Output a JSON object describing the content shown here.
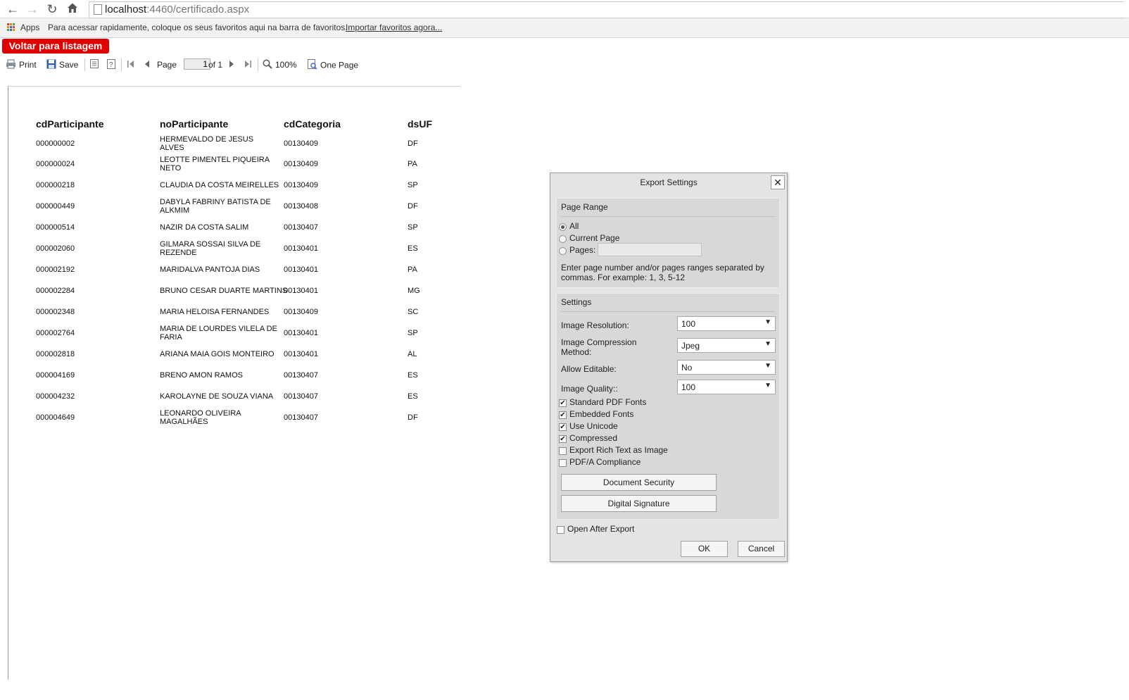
{
  "browser": {
    "url_host": "localhost",
    "url_path": ":4460/certificado.aspx",
    "bookmarks": {
      "apps_label": "Apps",
      "hint": "Para acessar rapidamente, coloque os seus favoritos aqui na barra de favoritos.",
      "import_link": "Importar favoritos agora..."
    }
  },
  "viewer": {
    "back_button": "Voltar para listagem",
    "toolbar": {
      "print": "Print",
      "save": "Save",
      "page_label": "Page",
      "page_value": "1",
      "page_of": "of 1",
      "zoom": "100%",
      "view_mode": "One Page"
    }
  },
  "report": {
    "columns": [
      "cdParticipante",
      "noParticipante",
      "cdCategoria",
      "dsUF"
    ],
    "rows": [
      [
        "000000002",
        "HERMEVALDO DE JESUS ALVES",
        "00130409",
        "DF"
      ],
      [
        "000000024",
        "LEOTTE PIMENTEL PIQUEIRA NETO",
        "00130409",
        "PA"
      ],
      [
        "000000218",
        "CLAUDIA DA COSTA MEIRELLES",
        "00130409",
        "SP"
      ],
      [
        "000000449",
        "DABYLA FABRINY BATISTA DE ALKMIM",
        "00130408",
        "DF"
      ],
      [
        "000000514",
        "NAZIR DA COSTA SALIM",
        "00130407",
        "SP"
      ],
      [
        "000002060",
        "GILMARA SOSSAI SILVA DE REZENDE",
        "00130401",
        "ES"
      ],
      [
        "000002192",
        "MARIDALVA PANTOJA DIAS",
        "00130401",
        "PA"
      ],
      [
        "000002284",
        "BRUNO CESAR DUARTE MARTINS",
        "00130401",
        "MG"
      ],
      [
        "000002348",
        "MARIA HELOISA FERNANDES",
        "00130409",
        "SC"
      ],
      [
        "000002764",
        "MARIA DE LOURDES VILELA DE FARIA",
        "00130401",
        "SP"
      ],
      [
        "000002818",
        "ARIANA MAIA GOIS MONTEIRO",
        "00130401",
        "AL"
      ],
      [
        "000004169",
        "BRENO AMON RAMOS",
        "00130407",
        "ES"
      ],
      [
        "000004232",
        "KAROLAYNE DE SOUZA VIANA",
        "00130407",
        "ES"
      ],
      [
        "000004649",
        "LEONARDO OLIVEIRA MAGALHÃES",
        "00130407",
        "DF"
      ]
    ]
  },
  "dialog": {
    "title": "Export Settings",
    "close_glyph": "✕",
    "page_range": {
      "title": "Page Range",
      "all": "All",
      "current_page": "Current Page",
      "pages": "Pages:",
      "pages_value": "",
      "help": "Enter page number and/or pages ranges separated by commas. For example: 1, 3, 5-12"
    },
    "settings": {
      "title": "Settings",
      "image_resolution_label": "Image Resolution:",
      "image_resolution_value": "100",
      "compression_label": "Image Compression Method:",
      "compression_value": "Jpeg",
      "allow_editable_label": "Allow Editable:",
      "allow_editable_value": "No",
      "image_quality_label": "Image Quality::",
      "image_quality_value": "100",
      "standard_pdf_fonts": "Standard PDF Fonts",
      "standard_pdf_fonts_checked": true,
      "embedded_fonts": "Embedded Fonts",
      "embedded_fonts_checked": true,
      "use_unicode": "Use Unicode",
      "use_unicode_checked": true,
      "compressed": "Compressed",
      "compressed_checked": true,
      "export_rich_text": "Export Rich Text as Image",
      "export_rich_text_checked": false,
      "pdfa_compliance": "PDF/A Compliance",
      "pdfa_compliance_checked": false,
      "document_security": "Document Security",
      "digital_signature": "Digital Signature"
    },
    "open_after_export": "Open After Export",
    "ok": "OK",
    "cancel": "Cancel"
  }
}
